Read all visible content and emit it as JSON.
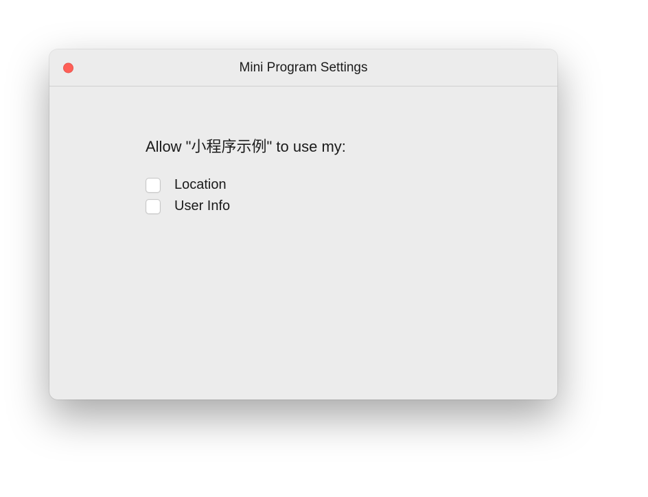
{
  "window": {
    "title": "Mini Program Settings"
  },
  "content": {
    "prompt": "Allow \"小程序示例\" to use my:",
    "permissions": [
      {
        "label": "Location",
        "checked": false
      },
      {
        "label": "User Info",
        "checked": false
      }
    ]
  }
}
